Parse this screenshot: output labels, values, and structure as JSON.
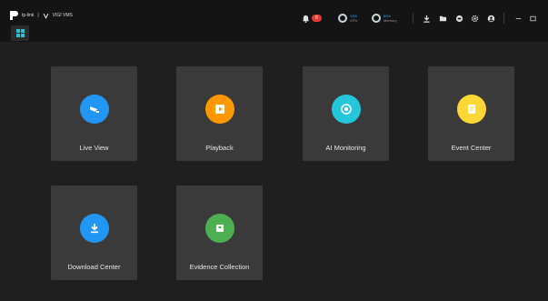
{
  "header": {
    "brand_text": "tp-link",
    "product_text": "VIGI VMS",
    "alarm_count": "8",
    "cpu": {
      "value": "13%",
      "key": "CPU"
    },
    "memory": {
      "value": "60%",
      "key": "Memory"
    }
  },
  "tiles": [
    {
      "label": "Live View",
      "color": "#2196f3",
      "icon": "camera-icon"
    },
    {
      "label": "Playback",
      "color": "#ff9800",
      "icon": "play-icon"
    },
    {
      "label": "AI Monitoring",
      "color": "#26c6da",
      "icon": "ai-target-icon"
    },
    {
      "label": "Event Center",
      "color": "#fdd835",
      "icon": "event-note-icon"
    },
    {
      "label": "Download Center",
      "color": "#2196f3",
      "icon": "download-icon"
    },
    {
      "label": "Evidence Collection",
      "color": "#4caf50",
      "icon": "evidence-box-icon"
    }
  ]
}
